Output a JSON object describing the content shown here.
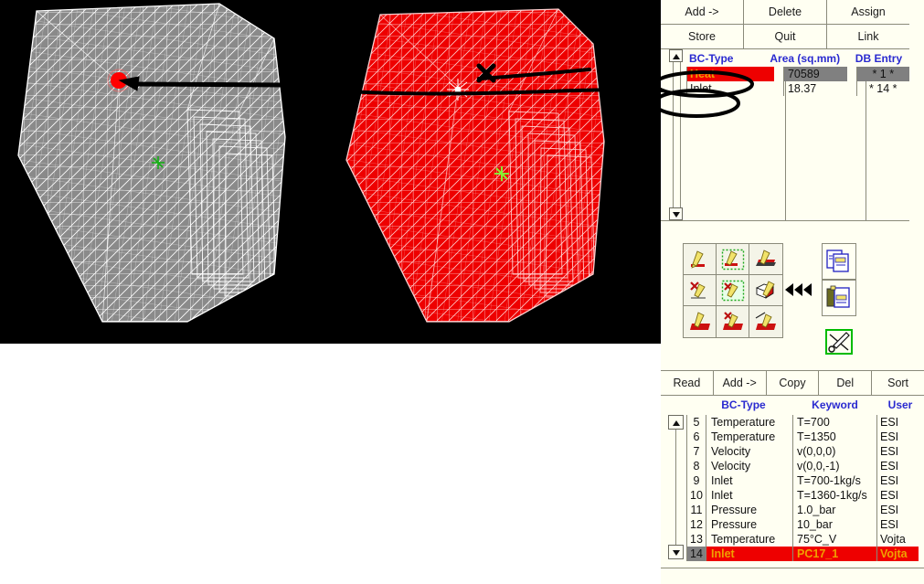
{
  "viewport": {
    "background_color": "#000000",
    "left_mesh": {
      "name": "surface-mesh-grey",
      "mesh_color": "#8a8a8a",
      "edge_color": "#ffffff",
      "marker_color": "#ff0000",
      "origin_marker_color": "#00cc00"
    },
    "right_mesh": {
      "name": "surface-mesh-red",
      "mesh_color": "#ee0000",
      "edge_color": "#ffc0c0",
      "origin_marker_color": "#88ff44"
    },
    "annotations": {
      "arrow_label": "pointer-arrow",
      "cross_label": "x-mark",
      "ellipse_label": "highlight-ellipse"
    }
  },
  "bc_panel": {
    "buttons_row1": [
      "Add ->",
      "Delete",
      "Assign"
    ],
    "buttons_row2": [
      "Store",
      "Quit",
      "Link"
    ],
    "columns": [
      "BC-Type",
      "Area (sq.mm)",
      "DB Entry"
    ],
    "rows": [
      {
        "bc_type": "Heat",
        "area": "70589",
        "db_entry": "* 1 *",
        "selected": true
      },
      {
        "bc_type": "Inlet",
        "area": "18.37",
        "db_entry": "* 14 *",
        "selected": false
      }
    ],
    "header_color": "#2a2ad0",
    "selected_row_bg": "#ee0000",
    "selected_row_fg": "#f0a000"
  },
  "icon_toolbar": {
    "grid": [
      "pencil-select-icon",
      "pencil-select-dashed-icon",
      "pencil-stack-icon",
      "pencil-delete-icon",
      "pencil-delete-dashed-icon",
      "pencil-box-icon",
      "pencil-fill-icon",
      "pencil-fill-delete-icon",
      "pencil-fill-line-icon"
    ],
    "side": [
      "copy-pages-icon",
      "clipboard-paste-icon",
      "tools-icon"
    ],
    "transfer_arrows": "double-left-arrow-icon"
  },
  "db_panel": {
    "buttons": [
      "Read",
      "Add ->",
      "Copy",
      "Del",
      "Sort"
    ],
    "columns": [
      "BC-Type",
      "Keyword",
      "User"
    ],
    "rows": [
      {
        "n": "5",
        "bc_type": "Temperature",
        "keyword": "T=700",
        "user": "ESI",
        "selected": false
      },
      {
        "n": "6",
        "bc_type": "Temperature",
        "keyword": "T=1350",
        "user": "ESI",
        "selected": false
      },
      {
        "n": "7",
        "bc_type": "Velocity",
        "keyword": "v(0,0,0)",
        "user": "ESI",
        "selected": false
      },
      {
        "n": "8",
        "bc_type": "Velocity",
        "keyword": "v(0,0,-1)",
        "user": "ESI",
        "selected": false
      },
      {
        "n": "9",
        "bc_type": "Inlet",
        "keyword": "T=700-1kg/s",
        "user": "ESI",
        "selected": false
      },
      {
        "n": "10",
        "bc_type": "Inlet",
        "keyword": "T=1360-1kg/s",
        "user": "ESI",
        "selected": false
      },
      {
        "n": "11",
        "bc_type": "Pressure",
        "keyword": "1.0_bar",
        "user": "ESI",
        "selected": false
      },
      {
        "n": "12",
        "bc_type": "Pressure",
        "keyword": "10_bar",
        "user": "ESI",
        "selected": false
      },
      {
        "n": "13",
        "bc_type": "Temperature",
        "keyword": "75°C_V",
        "user": "Vojta",
        "selected": false
      },
      {
        "n": "14",
        "bc_type": "Inlet",
        "keyword": "PC17_1",
        "user": "Vojta",
        "selected": true
      }
    ],
    "header_color": "#2a2ad0",
    "selected_row_bg": "#ee0000",
    "selected_row_fg": "#f0a000",
    "selected_index_bg": "#808080"
  }
}
